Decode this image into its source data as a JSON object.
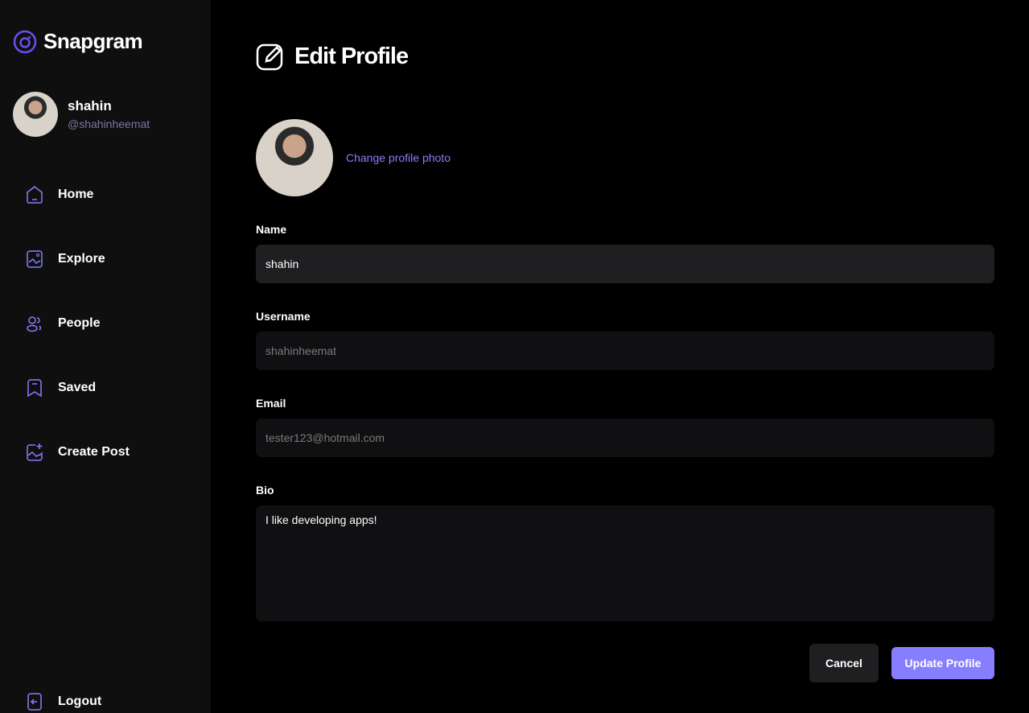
{
  "app": {
    "name": "Snapgram"
  },
  "user": {
    "name": "shahin",
    "username": "@shahinheemat"
  },
  "nav": [
    {
      "label": "Home",
      "icon": "home-icon"
    },
    {
      "label": "Explore",
      "icon": "explore-icon"
    },
    {
      "label": "People",
      "icon": "people-icon"
    },
    {
      "label": "Saved",
      "icon": "bookmark-icon"
    },
    {
      "label": "Create Post",
      "icon": "gallery-add-icon"
    }
  ],
  "logout": "Logout",
  "page": {
    "title": "Edit Profile",
    "change_photo": "Change profile photo",
    "fields": {
      "name_label": "Name",
      "name_value": "shahin",
      "username_label": "Username",
      "username_value": "shahinheemat",
      "email_label": "Email",
      "email_value": "tester123@hotmail.com",
      "bio_label": "Bio",
      "bio_value": "I like developing apps!"
    },
    "cancel": "Cancel",
    "update": "Update Profile"
  },
  "colors": {
    "accent": "#877eff",
    "sidebar": "#0f0f10"
  }
}
